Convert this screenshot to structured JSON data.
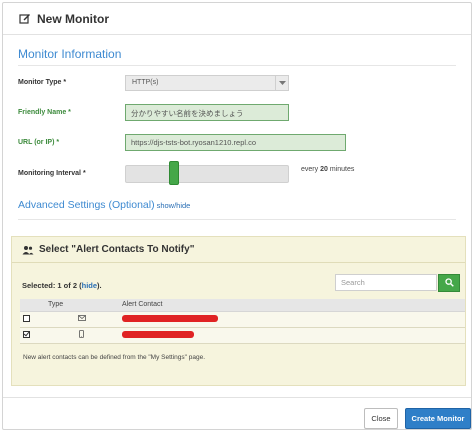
{
  "modal": {
    "title": "New Monitor"
  },
  "monitor_info": {
    "section_title": "Monitor Information",
    "type_label": "Monitor Type *",
    "type_value": "HTTP(s)",
    "friendly_label": "Friendly Name *",
    "friendly_value": "分かりやすい名前を決めましょう",
    "url_label": "URL (or IP) *",
    "url_value": "https://djs-tsts-bot.ryosan1210.repl.co",
    "interval_label": "Monitoring Interval *",
    "interval_prefix": "every",
    "interval_value": "20",
    "interval_unit": "minutes"
  },
  "advanced": {
    "title": "Advanced Settings (Optional)",
    "toggle": "show/hide"
  },
  "alerts": {
    "title": "Select \"Alert Contacts To Notify\"",
    "selected_prefix": "Selected: 1 of 2 (",
    "selected_link": "hide",
    "selected_suffix": ").",
    "search_placeholder": "Search",
    "columns": [
      "",
      "Type",
      "Alert Contact"
    ],
    "rows": [
      {
        "checked": false,
        "type_icon": "envelope-icon"
      },
      {
        "checked": true,
        "type_icon": "mobile-phone-icon"
      }
    ],
    "note": "New alert contacts can be defined from the \"My Settings\" page."
  },
  "footer": {
    "close_label": "Close",
    "create_label": "Create Monitor"
  },
  "colors": {
    "accent_blue": "#3e8ad1",
    "primary_button": "#2f7fc8",
    "green": "#45a749",
    "panel_bg": "#f6f4dd",
    "redaction": "#e02323"
  }
}
